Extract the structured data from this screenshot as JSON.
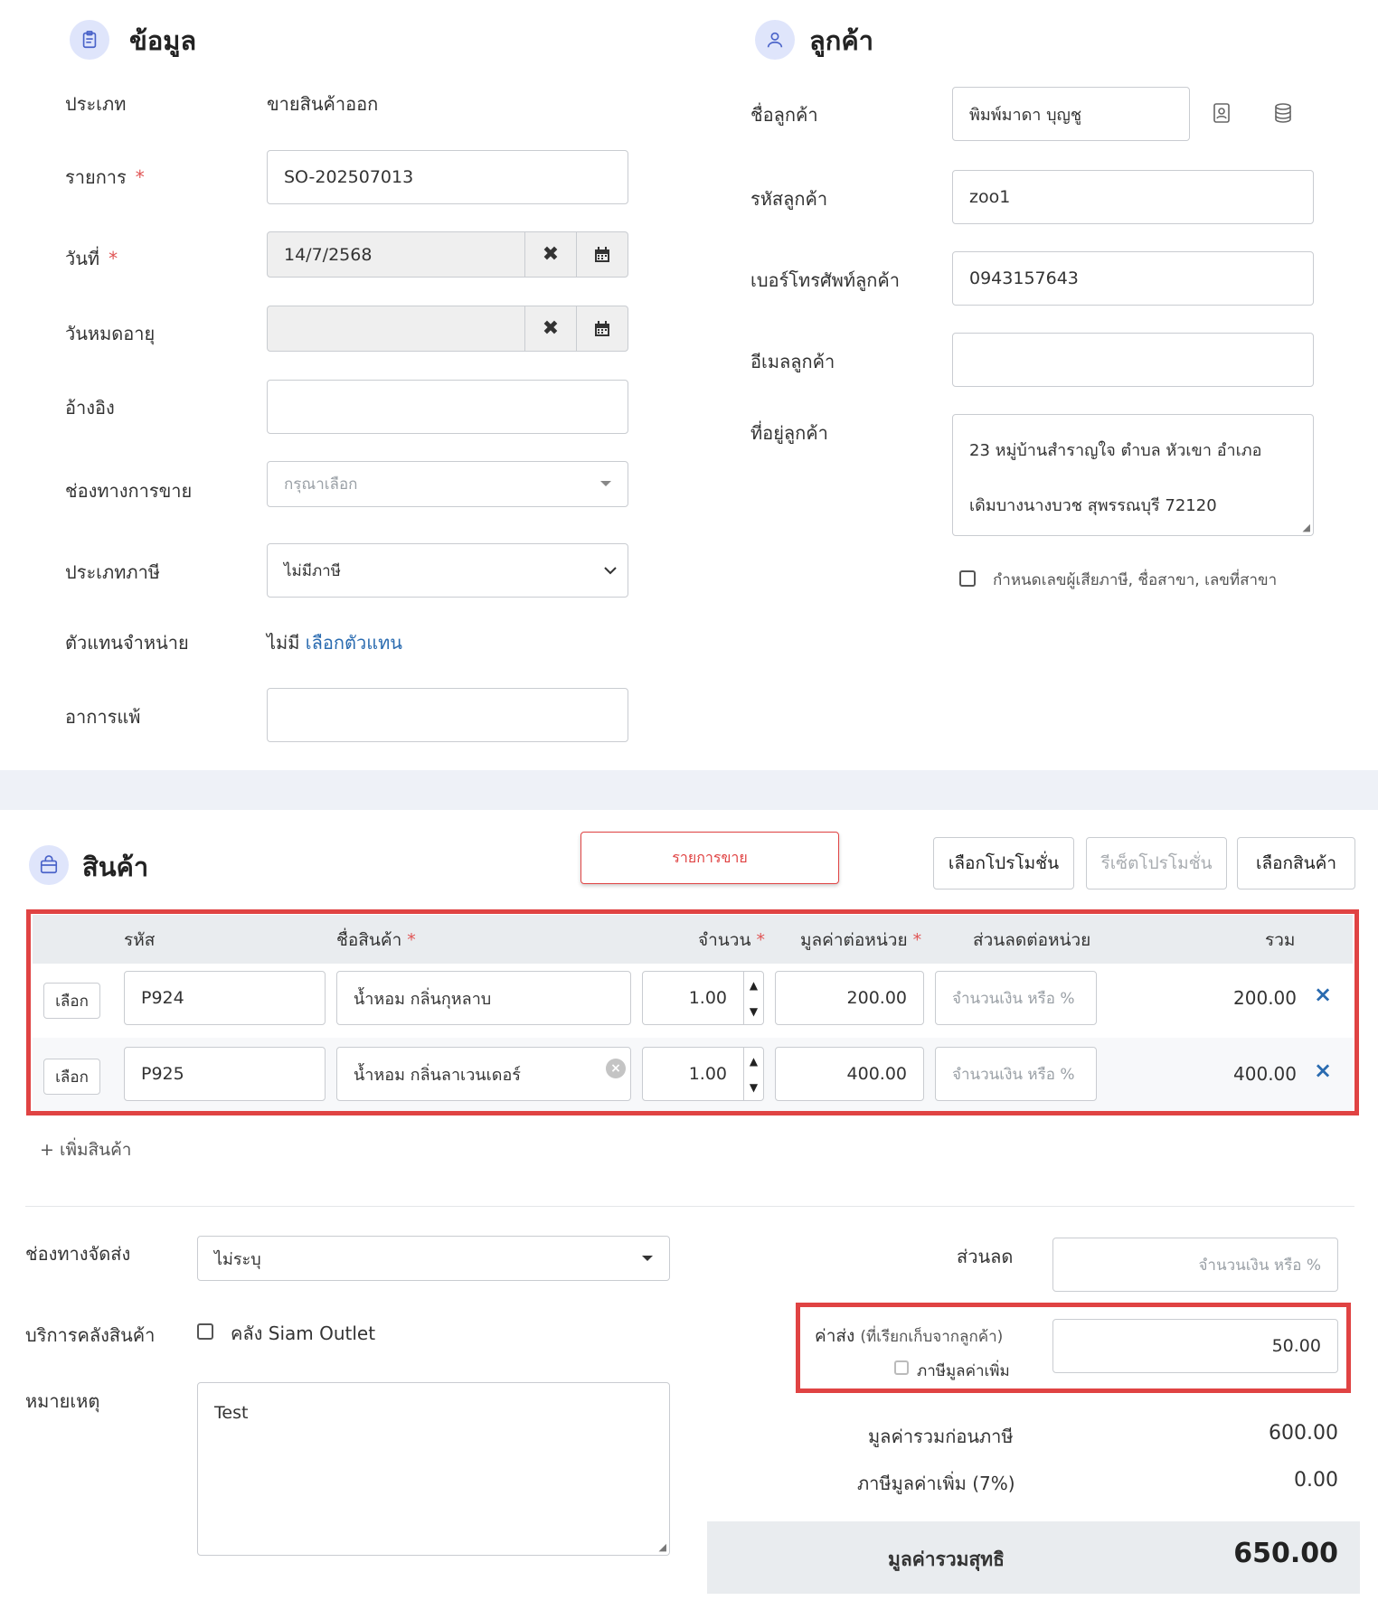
{
  "info": {
    "title": "ข้อมูล",
    "type_label": "ประเภท",
    "type_value": "ขายสินค้าออก",
    "doc_label": "รายการ",
    "doc_value": "SO-202507013",
    "date_label": "วันที่",
    "date_value": "14/7/2568",
    "expiry_label": "วันหมดอายุ",
    "expiry_value": "",
    "ref_label": "อ้างอิง",
    "ref_value": "",
    "channel_label": "ช่องทางการขาย",
    "channel_placeholder": "กรุณาเลือก",
    "tax_label": "ประเภทภาษี",
    "tax_value": "ไม่มีภาษี",
    "agent_label": "ตัวแทนจำหน่าย",
    "agent_value": "ไม่มี",
    "agent_link": "เลือกตัวแทน",
    "allergy_label": "อาการแพ้",
    "allergy_value": "",
    "required_mark": "*",
    "clear_icon": "✖"
  },
  "customer": {
    "title": "ลูกค้า",
    "name_label": "ชื่อลูกค้า",
    "name_value": "พิมพ์มาดา บุญชู",
    "code_label": "รหัสลูกค้า",
    "code_value": "zoo1",
    "phone_label": "เบอร์โทรศัพท์ลูกค้า",
    "phone_value": "0943157643",
    "email_label": "อีเมลลูกค้า",
    "email_value": "",
    "address_label": "ที่อยู่ลูกค้า",
    "address_line1": "23 หมู่บ้านสำราญใจ ตำบล หัวเขา อำเภอ",
    "address_line2": "เดิมบางนางบวช สุพรรณบุรี 72120",
    "tax_checkbox_label": "กำหนดเลขผู้เสียภาษี, ชื่อสาขา, เลขที่สาขา"
  },
  "products": {
    "title": "สินค้า",
    "tab_label": "รายการขาย",
    "btn_select_promo": "เลือกโปรโมชั่น",
    "btn_reset_promo": "รีเซ็ตโปรโมชั่น",
    "btn_select_product": "เลือกสินค้า",
    "headers": {
      "code": "รหัส",
      "name": "ชื่อสินค้า",
      "qty": "จำนวน",
      "unit_price": "มูลค่าต่อหน่วย",
      "discount": "ส่วนลดต่อหน่วย",
      "total": "รวม"
    },
    "select_label": "เลือก",
    "discount_placeholder": "จำนวนเงิน หรือ %",
    "delete_icon": "×",
    "rows": [
      {
        "code": "P924",
        "name": "น้ำหอม กลิ่นกุหลาบ",
        "qty": "1.00",
        "unit_price": "200.00",
        "total": "200.00"
      },
      {
        "code": "P925",
        "name": "น้ำหอม กลิ่นลาเวนเดอร์",
        "qty": "1.00",
        "unit_price": "400.00",
        "total": "400.00"
      }
    ],
    "add_label": "+ เพิ่มสินค้า"
  },
  "shipping": {
    "channel_label": "ช่องทางจัดส่ง",
    "channel_value": "ไม่ระบุ",
    "warehouse_label": "บริการคลังสินค้า",
    "warehouse_option": "คลัง Siam Outlet",
    "note_label": "หมายเหตุ",
    "note_value": "Test"
  },
  "summary": {
    "discount_label": "ส่วนลด",
    "discount_placeholder": "จำนวนเงิน หรือ %",
    "shipping_fee_label": "ค่าส่ง",
    "shipping_fee_sub": "(ที่เรียกเก็บจากลูกค้า)",
    "shipping_fee_value": "50.00",
    "vat_checkbox_label": "ภาษีมูลค่าเพิ่ม",
    "subtotal_label": "มูลค่ารวมก่อนภาษี",
    "subtotal_value": "600.00",
    "vat_label": "ภาษีมูลค่าเพิ่ม (7%)",
    "vat_value": "0.00",
    "net_label": "มูลค่ารวมสุทธิ",
    "net_value": "650.00"
  },
  "colors": {
    "accent": "#2a6bb0",
    "highlight_border": "#e04343",
    "required": "#e05555",
    "icon_bg": "#dfe5fb"
  }
}
